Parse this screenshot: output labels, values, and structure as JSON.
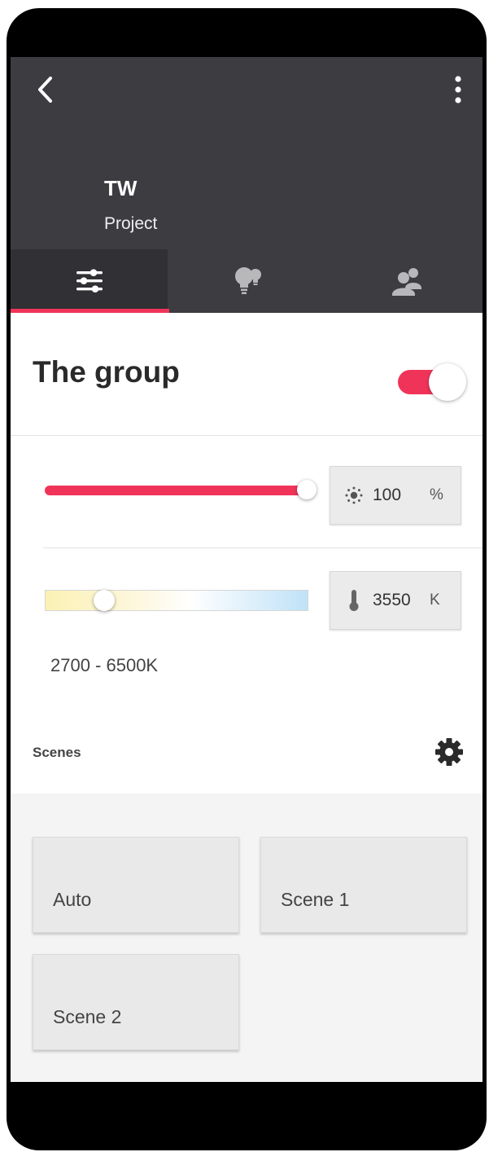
{
  "header": {
    "title": "TW",
    "subtitle": "Project"
  },
  "tabs": [
    {
      "icon": "sliders-icon",
      "active": true
    },
    {
      "icon": "bulbs-icon",
      "active": false
    },
    {
      "icon": "users-icon",
      "active": false
    }
  ],
  "group": {
    "title": "The group",
    "enabled": true
  },
  "brightness": {
    "value": "100",
    "unit": "%",
    "level_percent": 100,
    "icon": "sun-icon"
  },
  "temperature": {
    "value": "3550",
    "unit": "K",
    "icon": "thermometer-icon",
    "range_label": "2700 - 6500K"
  },
  "scenes": {
    "title": "Scenes",
    "settings_icon": "gear-icon",
    "items": [
      {
        "label": "Auto"
      },
      {
        "label": "Scene 1"
      },
      {
        "label": "Scene 2"
      }
    ]
  },
  "colors": {
    "accent": "#f03459",
    "appbar": "#3d3c41"
  }
}
